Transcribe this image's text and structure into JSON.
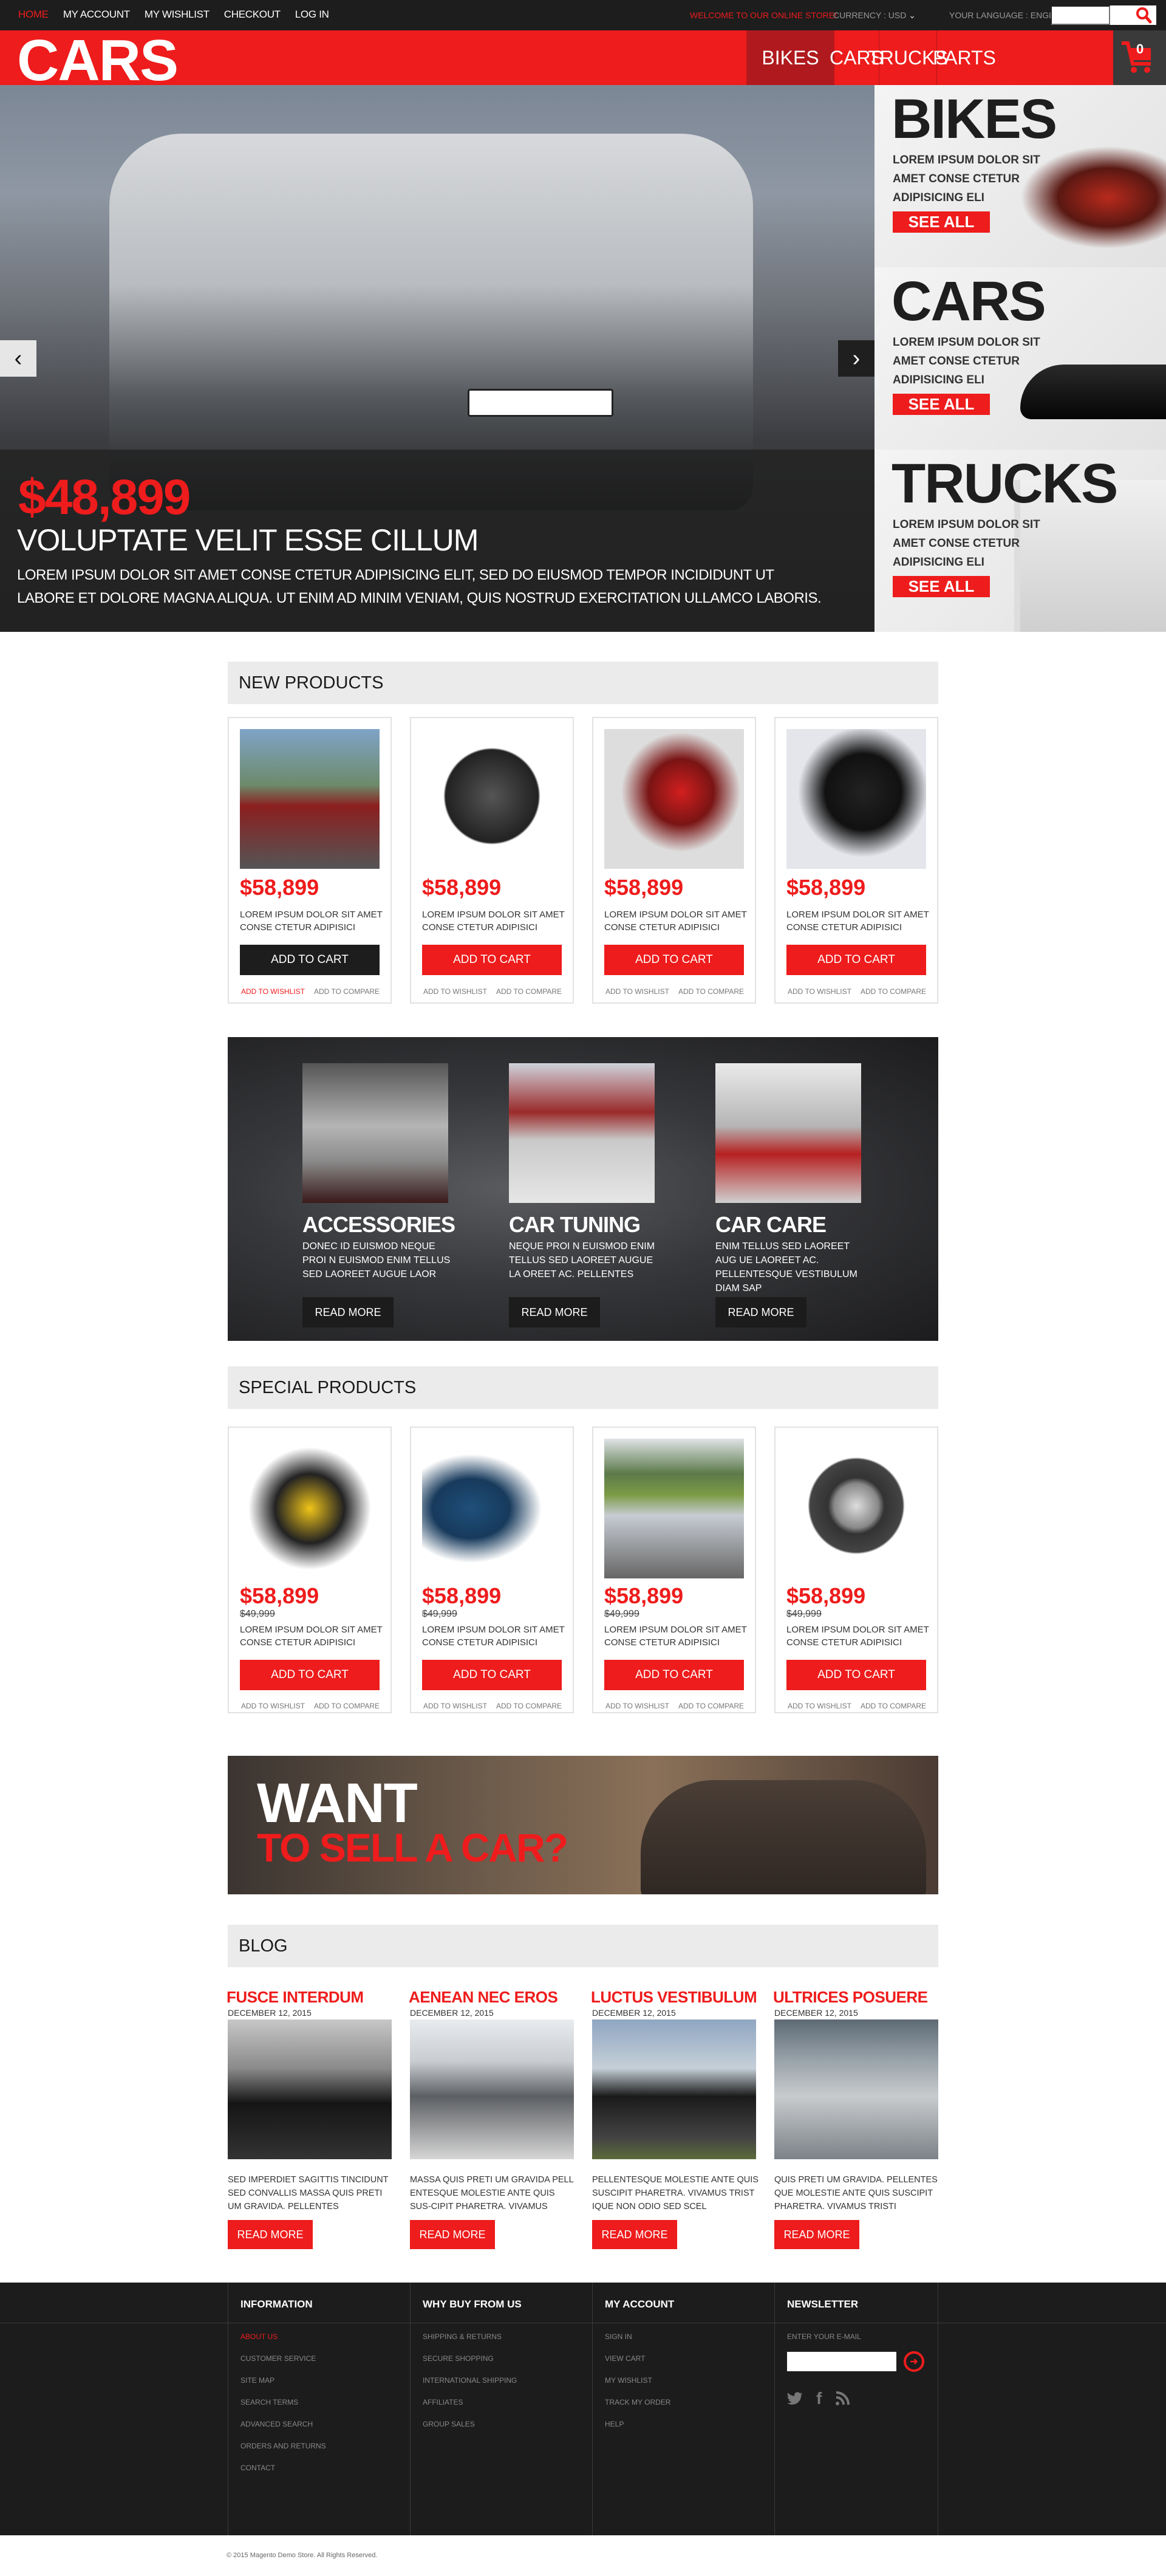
{
  "topbar": {
    "links": [
      "HOME",
      "MY ACCOUNT",
      "MY WISHLIST",
      "CHECKOUT",
      "LOG IN"
    ],
    "active_link": "HOME",
    "welcome": "WELCOME TO OUR ONLINE STORE!",
    "currency": "CURRENCY : USD",
    "language": "YOUR LANGUAGE : ENGLISH",
    "search_placeholder": ""
  },
  "header": {
    "logo": "CARS",
    "nav": [
      "BIKES",
      "CARS",
      "TRUCKS",
      "PARTS"
    ],
    "active_nav": "BIKES",
    "cart_count": "0"
  },
  "hero": {
    "price": "$48,899",
    "title": "VOLUPTATE VELIT ESSE CILLUM",
    "text": "LOREM IPSUM DOLOR SIT AMET CONSE CTETUR ADIPISICING ELIT, SED DO EIUSMOD TEMPOR INCIDIDUNT UT LABORE ET DOLORE MAGNA ALIQUA. UT ENIM AD MINIM VENIAM, QUIS NOSTRUD EXERCITATION ULLAMCO LABORIS.",
    "prev": "‹",
    "next": "›"
  },
  "side_banners": [
    {
      "title": "BIKES",
      "text": "LOREM IPSUM DOLOR SIT AMET CONSE CTETUR ADIPISICING ELI",
      "button": "SEE ALL"
    },
    {
      "title": "CARS",
      "text": "LOREM IPSUM DOLOR SIT AMET CONSE CTETUR ADIPISICING ELI",
      "button": "SEE ALL"
    },
    {
      "title": "TRUCKS",
      "text": "LOREM IPSUM DOLOR SIT AMET CONSE CTETUR ADIPISICING ELI",
      "button": "SEE ALL"
    }
  ],
  "new_products": {
    "heading": "NEW PRODUCTS",
    "items": [
      {
        "image": "red SUV",
        "price": "$58,899",
        "desc": "LOREM IPSUM DOLOR SIT AMET CONSE CTETUR ADIPISICI",
        "cart": "ADD TO CART",
        "wishlist": "ADD TO WISHLIST",
        "compare": "ADD TO COMPARE"
      },
      {
        "image": "black wheel",
        "price": "$58,899",
        "desc": "LOREM IPSUM DOLOR SIT AMET CONSE CTETUR ADIPISICI",
        "cart": "ADD TO CART",
        "wishlist": "ADD TO WISHLIST",
        "compare": "ADD TO COMPARE"
      },
      {
        "image": "red sport bike",
        "price": "$58,899",
        "desc": "LOREM IPSUM DOLOR SIT AMET CONSE CTETUR ADIPISICI",
        "cart": "ADD TO CART",
        "wishlist": "ADD TO WISHLIST",
        "compare": "ADD TO COMPARE"
      },
      {
        "image": "black sport bike",
        "price": "$58,899",
        "desc": "LOREM IPSUM DOLOR SIT AMET CONSE CTETUR ADIPISICI",
        "cart": "ADD TO CART",
        "wishlist": "ADD TO WISHLIST",
        "compare": "ADD TO COMPARE"
      }
    ]
  },
  "promo": [
    {
      "title": "ACCESSORIES",
      "text": "DONEC ID EUISMOD NEQUE PROI N EUISMOD ENIM TELLUS SED LAOREET AUGUE LAOR",
      "button": "READ MORE"
    },
    {
      "title": "CAR TUNING",
      "text": "NEQUE PROI N EUISMOD ENIM TELLUS SED LAOREET AUGUE LA OREET AC. PELLENTES",
      "button": "READ MORE"
    },
    {
      "title": "CAR CARE",
      "text": "ENIM TELLUS SED LAOREET AUG UE LAOREET AC. PELLENTESQUE VESTIBULUM DIAM SAP",
      "button": "READ MORE"
    }
  ],
  "special_products": {
    "heading": "SPECIAL PRODUCTS",
    "items": [
      {
        "image": "yellow motorbike",
        "price": "$58,899",
        "old_price": "$49,999",
        "desc": "LOREM IPSUM DOLOR SIT AMET CONSE CTETUR ADIPISICI",
        "cart": "ADD TO CART",
        "wishlist": "ADD TO WISHLIST",
        "compare": "ADD TO COMPARE"
      },
      {
        "image": "blue truck",
        "price": "$58,899",
        "old_price": "$49,999",
        "desc": "LOREM IPSUM DOLOR SIT AMET CONSE CTETUR ADIPISICI",
        "cart": "ADD TO CART",
        "wishlist": "ADD TO WISHLIST",
        "compare": "ADD TO COMPARE"
      },
      {
        "image": "silver SUV",
        "price": "$58,899",
        "old_price": "$49,999",
        "desc": "LOREM IPSUM DOLOR SIT AMET CONSE CTETUR ADIPISICI",
        "cart": "ADD TO CART",
        "wishlist": "ADD TO WISHLIST",
        "compare": "ADD TO COMPARE"
      },
      {
        "image": "chrome wheel",
        "price": "$58,899",
        "old_price": "$49,999",
        "desc": "LOREM IPSUM DOLOR SIT AMET CONSE CTETUR ADIPISICI",
        "cart": "ADD TO CART",
        "wishlist": "ADD TO WISHLIST",
        "compare": "ADD TO COMPARE"
      }
    ]
  },
  "want_banner": {
    "line1": "WANT",
    "line2": "TO SELL A CAR?"
  },
  "blog": {
    "heading": "BLOG",
    "posts": [
      {
        "title": "FUSCE INTERDUM",
        "date": "DECEMBER 12, 2015",
        "text": "SED IMPERDIET SAGITTIS TINCIDUNT SED CONVALLIS MASSA QUIS PRETI UM GRAVIDA. PELLENTES",
        "button": "READ MORE"
      },
      {
        "title": "AENEAN NEC EROS",
        "date": "DECEMBER 12, 2015",
        "text": "MASSA QUIS PRETI UM GRAVIDA PELL ENTESQUE MOLESTIE ANTE QUIS SUS-CIPIT PHARETRA. VIVAMUS",
        "button": "READ MORE"
      },
      {
        "title": "LUCTUS VESTIBULUM",
        "date": "DECEMBER 12, 2015",
        "text": "PELLENTESQUE MOLESTIE ANTE QUIS SUSCIPIT PHARETRA. VIVAMUS TRIST IQUE NON ODIO SED SCEL",
        "button": "READ MORE"
      },
      {
        "title": "ULTRICES POSUERE",
        "date": "DECEMBER 12, 2015",
        "text": "QUIS PRETI UM GRAVIDA. PELLENTES QUE MOLESTIE ANTE QUIS SUSCIPIT PHARETRA. VIVAMUS TRISTI",
        "button": "READ MORE"
      }
    ]
  },
  "footer": {
    "columns": [
      {
        "title": "INFORMATION",
        "links": [
          "ABOUT US",
          "CUSTOMER SERVICE",
          "SITE MAP",
          "SEARCH TERMS",
          "ADVANCED SEARCH",
          "ORDERS AND RETURNS",
          "CONTACT"
        ]
      },
      {
        "title": "WHY BUY FROM US",
        "links": [
          "SHIPPING & RETURNS",
          "SECURE SHOPPING",
          "INTERNATIONAL SHIPPING",
          "AFFILIATES",
          "GROUP SALES"
        ]
      },
      {
        "title": "MY ACCOUNT",
        "links": [
          "SIGN IN",
          "VIEW CART",
          "MY WISHLIST",
          "TRACK MY ORDER",
          "HELP"
        ]
      }
    ],
    "newsletter": {
      "title": "NEWSLETTER",
      "label": "ENTER YOUR E-MAIL",
      "placeholder": ""
    },
    "social": [
      "twitter",
      "facebook",
      "rss"
    ],
    "copyright": "© 2015 Magento Demo Store. All Rights Reserved."
  },
  "colors": {
    "accent": "#ee1c1c",
    "dark": "#1d1d1d",
    "panel": "#ebebeb"
  }
}
